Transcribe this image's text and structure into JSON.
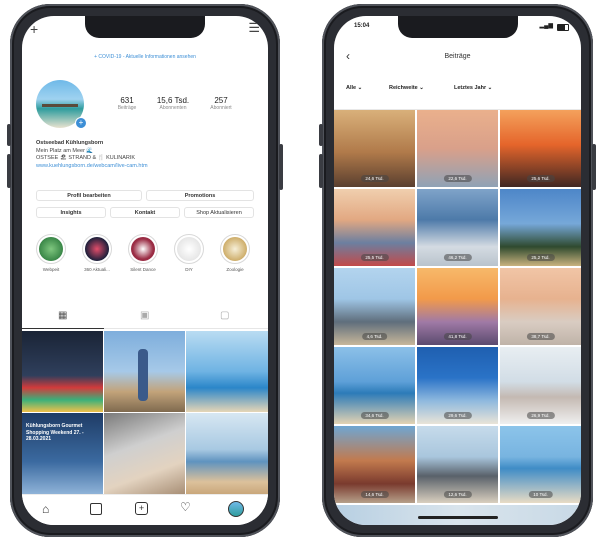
{
  "left": {
    "topbar": {
      "plus_icon": "plus-icon",
      "menu_icon": "hamburger-icon"
    },
    "covid_link": "+ COVID-19 - Aktuelle Informationen ansehen",
    "stats": [
      {
        "value": "631",
        "label": "Beiträge"
      },
      {
        "value": "15,6 Tsd.",
        "label": "Abonnenten"
      },
      {
        "value": "257",
        "label": "Abonniert"
      }
    ],
    "bio": {
      "name": "Ostseebad Kühlungsborn",
      "line1": "Mein Platz am Meer 🌊",
      "line2": "OSTSEE 🏖 STRAND & 🍴 KULINARIK",
      "link": "www.kuehlungsborn.de/webcam/live-cam.htm"
    },
    "buttons": {
      "edit": "Profil bearbeiten",
      "promotions": "Promotions",
      "insights": "Insights",
      "contact": "Kontakt",
      "shop": "Shop Aktualisieren"
    },
    "highlights": [
      {
        "label": "Webpeit",
        "color": "#2f7d3f"
      },
      {
        "label": "360 Aktuali...",
        "color": "#1b1f3a"
      },
      {
        "label": "Silent Dance",
        "color": "#6a1d2e"
      },
      {
        "label": "DIY",
        "color": "#f0f0f0"
      },
      {
        "label": "Zoologie",
        "color": "#d8c48a"
      }
    ],
    "grid_tabs": {
      "grid_icon": "grid-icon",
      "reels_icon": "reels-icon",
      "tagged_icon": "tagged-icon"
    },
    "posts": [
      {
        "c1": "#1e2f4a",
        "c2": "#c23a3a"
      },
      {
        "c1": "#6a9bc6",
        "c2": "#9b7a55"
      },
      {
        "c1": "#5aa3d6",
        "c2": "#cfe3f0"
      },
      {
        "c1": "#2c4f7a",
        "c2": "#7fa6cf"
      },
      {
        "c1": "#8e8e8e",
        "c2": "#d9c6b0"
      },
      {
        "c1": "#c7dbe9",
        "c2": "#d6b58f"
      }
    ],
    "post_banner": "Kühlungsborn Gourmet Shopping Weekend 27. - 28.03.2021",
    "bottom_nav": [
      "home-icon",
      "shop-icon",
      "add-icon",
      "heart-icon",
      "profile-avatar"
    ]
  },
  "right": {
    "status": {
      "time": "15:04",
      "signal": "▂▄▆"
    },
    "header": {
      "back_icon": "back-arrow-icon",
      "title": "Beiträge"
    },
    "filters": [
      "Alle",
      "Reichweite",
      "Letztes Jahr"
    ],
    "tiles": [
      {
        "reach": "24,6 Tsd.",
        "c1": "#d3a46b",
        "c2": "#6b4a35"
      },
      {
        "reach": "22,6 Tsd.",
        "c1": "#e5a27b",
        "c2": "#9aa9b7"
      },
      {
        "reach": "25,6 Tsd.",
        "c1": "#f07a3a",
        "c2": "#4a2f2a"
      },
      {
        "reach": "25,5 Tsd.",
        "c1": "#e9c19b",
        "c2": "#5a6b86"
      },
      {
        "reach": "46,2 Tsd.",
        "c1": "#4d7aa9",
        "c2": "#c7cfd8"
      },
      {
        "reach": "25,2 Tsd.",
        "c1": "#5a8bc4",
        "c2": "#2f4a2f"
      },
      {
        "reach": "4,6 Tsd.",
        "c1": "#9fc6e6",
        "c2": "#7a8896"
      },
      {
        "reach": "41,8 Tsd.",
        "c1": "#f29a4a",
        "c2": "#7a5f8a"
      },
      {
        "reach": "38,7 Tsd.",
        "c1": "#e7b28f",
        "c2": "#d8c4b5"
      },
      {
        "reach": "34,6 Tsd.",
        "c1": "#5ea0d8",
        "c2": "#d9c7a8"
      },
      {
        "reach": "29,6 Tsd.",
        "c1": "#2a73c7",
        "c2": "#c6dcec"
      },
      {
        "reach": "26,9 Tsd.",
        "c1": "#d9e3ea",
        "c2": "#f2f2f2"
      },
      {
        "reach": "14,6 Tsd.",
        "c1": "#6fa6d2",
        "c2": "#7a3a2e"
      },
      {
        "reach": "12,6 Tsd.",
        "c1": "#a9c6dd",
        "c2": "#59616a"
      },
      {
        "reach": "10 Tsd.",
        "c1": "#78b4e0",
        "c2": "#e8dcc5"
      }
    ]
  }
}
